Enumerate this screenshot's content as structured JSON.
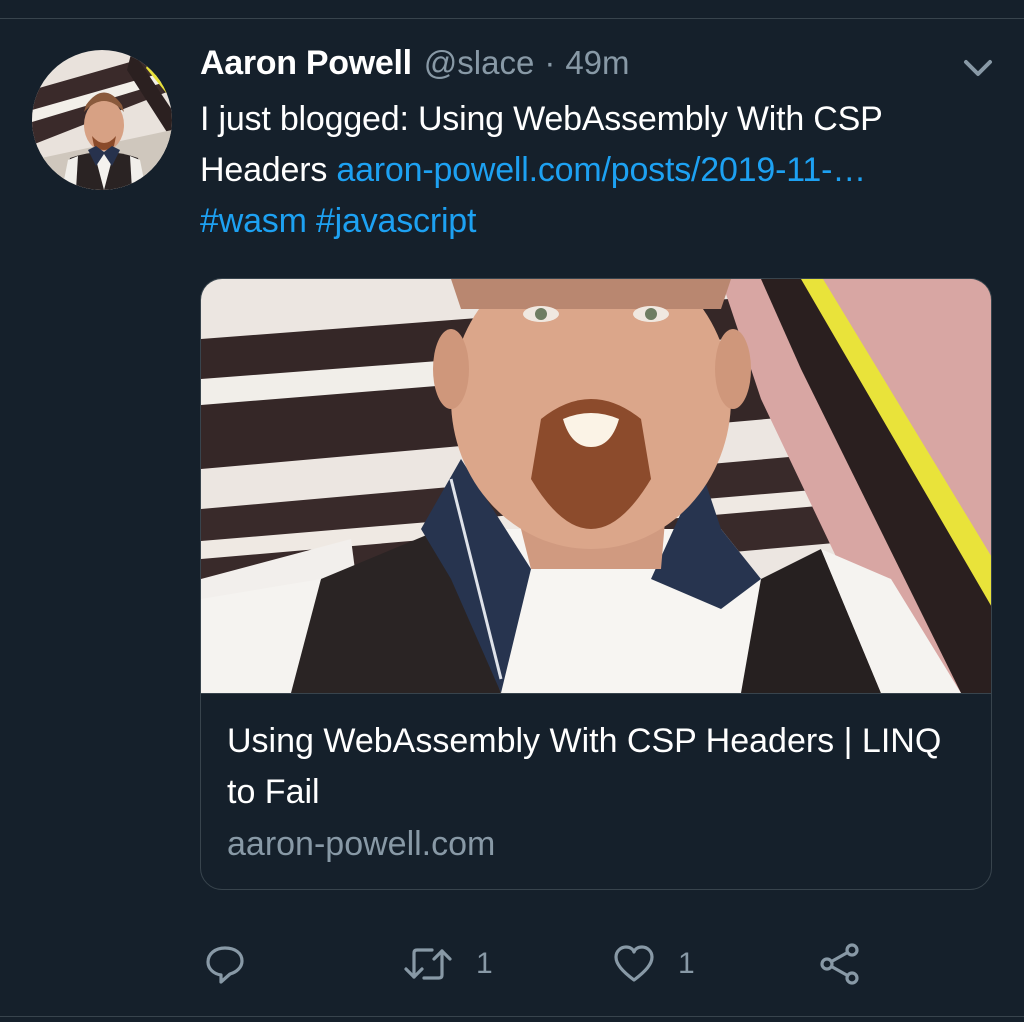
{
  "tweet": {
    "author_name": "Aaron Powell",
    "handle": "@slace",
    "separator": "·",
    "time": "49m",
    "text_prefix": "I just blogged: Using WebAssembly With CSP Headers ",
    "link_text": "aaron-powell.com/posts/2019-11-…",
    "hashtags": [
      "#wasm",
      "#javascript"
    ]
  },
  "card": {
    "title": "Using WebAssembly With CSP Headers | LINQ to Fail",
    "domain": "aaron-powell.com"
  },
  "actions": {
    "reply_icon": "reply-icon",
    "retweet_icon": "retweet-icon",
    "retweet_count": "1",
    "like_icon": "heart-icon",
    "like_count": "1",
    "share_icon": "share-icon"
  },
  "colors": {
    "background": "#15202b",
    "link": "#1da1f2",
    "secondary_text": "#8899a6",
    "border": "#38444d"
  }
}
